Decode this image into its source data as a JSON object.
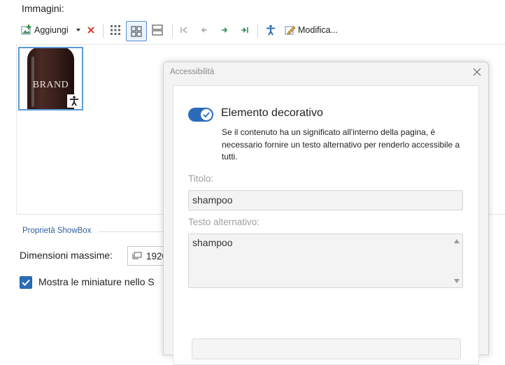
{
  "section": {
    "images_label": "Immagini:"
  },
  "toolbar": {
    "add_label": "Aggiungi",
    "edit_label": "Modifica...",
    "icons": [
      "add-image-icon",
      "dropdown-arrow-icon",
      "delete-icon",
      "small-grid-icon",
      "large-grid-icon",
      "list-view-icon",
      "first-icon",
      "previous-icon",
      "next-icon",
      "last-icon",
      "accessibility-icon",
      "edit-icon"
    ]
  },
  "gallery": {
    "items": [
      {
        "brand_text": "BRAND"
      }
    ]
  },
  "properties": {
    "group_label": "Proprietà ShowBox",
    "max_dim_label": "Dimensioni massime:",
    "max_dim_value": "1920",
    "thumbnails_label": "Mostra le miniature nello S",
    "thumbnails_checked": true
  },
  "dialog": {
    "title": "Accessibilità",
    "decorative_label": "Elemento decorativo",
    "decorative_on": true,
    "description": "Se il contenuto ha un significato all'interno della pagina, è necessario fornire un testo alternativo per renderlo accessibile a tutti.",
    "title_field_label": "Titolo:",
    "title_field_value": "shampoo",
    "alt_field_label": "Testo alternativo:",
    "alt_field_value": "shampoo"
  },
  "colors": {
    "accent": "#2b6cb8",
    "selection_border": "#5b9bd5"
  }
}
